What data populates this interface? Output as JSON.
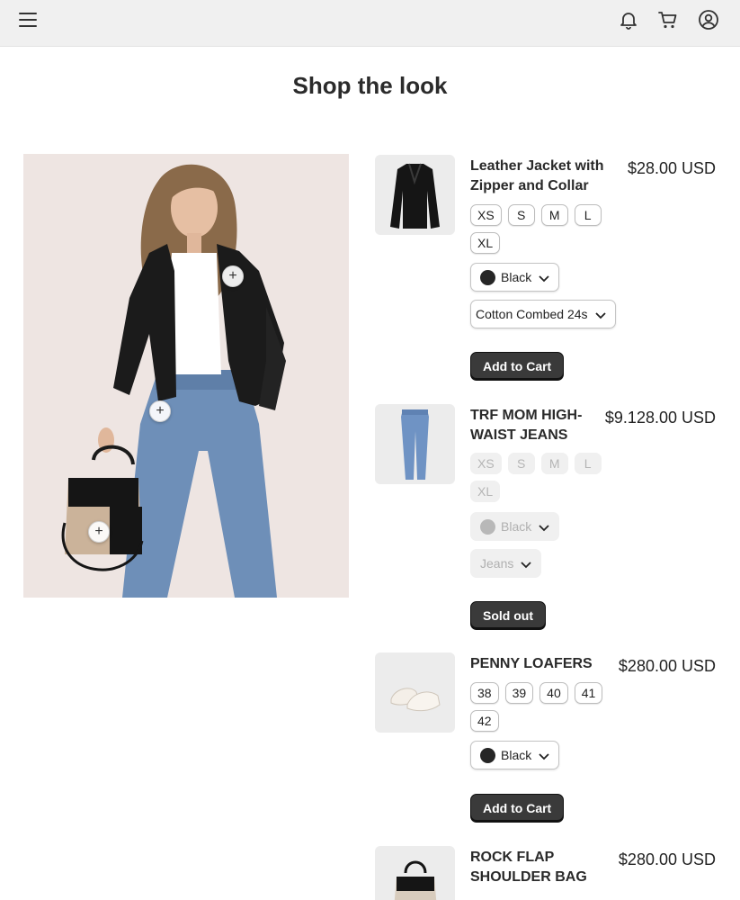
{
  "header": {
    "menu_icon": "hamburger-menu-icon",
    "icons": [
      "bell-icon",
      "cart-icon",
      "user-circle-icon"
    ]
  },
  "page": {
    "title": "Shop the look"
  },
  "hero": {
    "hotspots": [
      "+",
      "+",
      "+"
    ]
  },
  "products": [
    {
      "name": "Leather Jacket with Zipper and Collar",
      "price": "$28.00 USD",
      "sizes": [
        "XS",
        "S",
        "M",
        "L",
        "XL"
      ],
      "color": "Black",
      "variant": "Cotton Combed 24s",
      "button": "Add to Cart",
      "available": true
    },
    {
      "name": "TRF MOM HIGH-WAIST JEANS",
      "price": "$9.128.00 USD",
      "sizes": [
        "XS",
        "S",
        "M",
        "L",
        "XL"
      ],
      "color": "Black",
      "variant": "Jeans",
      "button": "Sold out",
      "available": false
    },
    {
      "name": "PENNY LOAFERS",
      "price": "$280.00 USD",
      "sizes": [
        "38",
        "39",
        "40",
        "41",
        "42"
      ],
      "color": "Black",
      "button": "Add to Cart",
      "available": true
    },
    {
      "name": "ROCK FLAP SHOULDER BAG",
      "price": "$280.00 USD",
      "available": true
    }
  ],
  "colors": {
    "topbar": "#f0f0f0",
    "button": "#3a3a3a",
    "thumb_bg": "#ececec"
  }
}
